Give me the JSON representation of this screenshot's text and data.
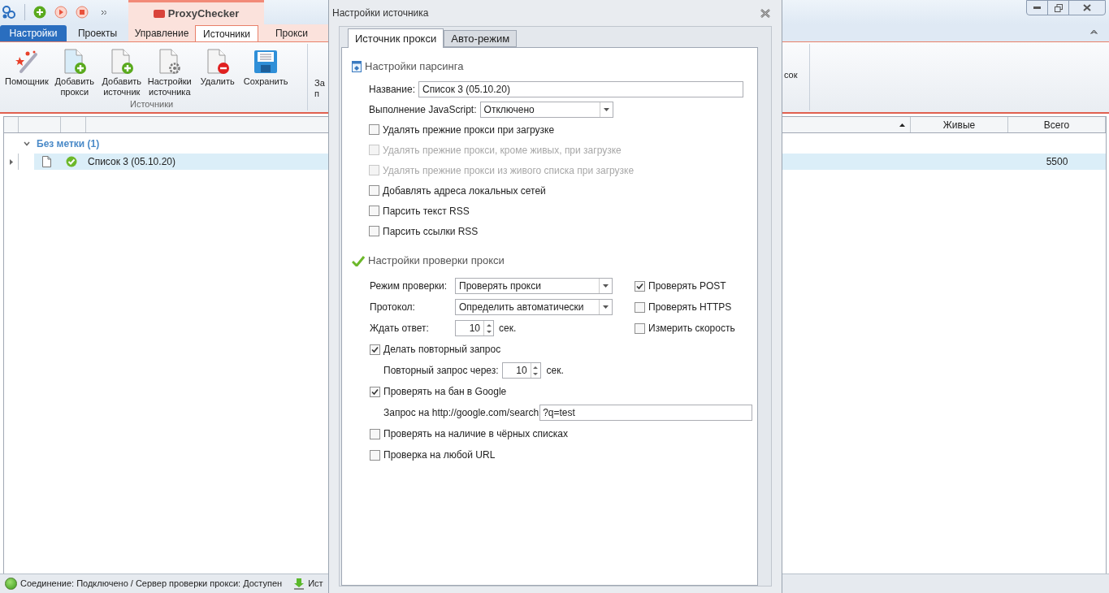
{
  "app": {
    "title": "ProxyChecker"
  },
  "ribbon": {
    "tabs": [
      {
        "label": "Настройки",
        "kind": "file",
        "selected": false
      },
      {
        "label": "Проекты",
        "kind": "plain",
        "selected": false
      },
      {
        "label": "Управление",
        "kind": "context",
        "selected": false
      },
      {
        "label": "Источники",
        "kind": "context",
        "selected": true
      },
      {
        "label": "Прокси",
        "kind": "context",
        "selected": false
      }
    ],
    "buttons": [
      {
        "kind": "wand",
        "label": "Помощник"
      },
      {
        "kind": "add-proxy",
        "label": "Добавить прокси"
      },
      {
        "kind": "add-source",
        "label": "Добавить источник"
      },
      {
        "kind": "settings",
        "label": "Настройки источника"
      },
      {
        "kind": "delete",
        "label": "Удалить"
      },
      {
        "kind": "save",
        "label": "Сохранить"
      }
    ],
    "group_label": "Источники",
    "cut_button_lines": [
      "За",
      "п"
    ],
    "cut_right_label": "сок"
  },
  "grid": {
    "columns": [
      {
        "label": "Живые"
      },
      {
        "label": "Всего"
      }
    ],
    "groups": [
      {
        "label": "Без метки (1)",
        "expanded": true,
        "rows": [
          {
            "name": "Список 3 (05.10.20)",
            "selected": true,
            "live": "",
            "total": "5500"
          }
        ]
      }
    ]
  },
  "status_bar": {
    "connection": "Соединение: Подключено / Сервер проверки прокси: Доступен",
    "next": "Ист"
  },
  "dialog": {
    "title": "Настройки источника",
    "tabs": [
      {
        "label": "Источник прокси",
        "selected": true
      },
      {
        "label": "Авто-режим",
        "selected": false
      }
    ],
    "parsing": {
      "title": "Настройки парсинга",
      "name_label": "Название:",
      "name_value": "Список 3 (05.10.20)",
      "js_label": "Выполнение JavaScript:",
      "js_value": "Отключено",
      "checkboxes": [
        {
          "label": "Удалять прежние прокси при загрузке",
          "checked": false,
          "disabled": false
        },
        {
          "label": "Удалять прежние прокси, кроме живых, при загрузке",
          "checked": false,
          "disabled": true
        },
        {
          "label": "Удалять прежние прокси из живого списка при загрузке",
          "checked": false,
          "disabled": true
        },
        {
          "label": "Добавлять адреса локальных сетей",
          "checked": false,
          "disabled": false
        },
        {
          "label": "Парсить текст RSS",
          "checked": false,
          "disabled": false
        },
        {
          "label": "Парсить ссылки RSS",
          "checked": false,
          "disabled": false
        }
      ]
    },
    "checking": {
      "title": "Настройки проверки прокси",
      "mode_label": "Режим проверки:",
      "mode_value": "Проверять прокси",
      "protocol_label": "Протокол:",
      "protocol_value": "Определить автоматически",
      "wait_label": "Ждать ответ:",
      "wait_value": "10",
      "wait_unit": "сек.",
      "side_checkboxes": [
        {
          "label": "Проверять POST",
          "checked": true
        },
        {
          "label": "Проверять HTTPS",
          "checked": false
        },
        {
          "label": "Измерить скорость",
          "checked": false
        }
      ],
      "retry": {
        "label": "Делать повторный запрос",
        "checked": true,
        "delay_label": "Повторный запрос через:",
        "delay_value": "10",
        "delay_unit": "сек."
      },
      "google": {
        "label": "Проверять на бан в Google",
        "checked": true,
        "query_label": "Запрос на http://google.com/search",
        "query_value": "?q=test"
      },
      "checkboxes": [
        {
          "label": "Проверять на наличие в чёрных списках",
          "checked": false
        },
        {
          "label": "Проверка на любой URL",
          "checked": false
        }
      ]
    }
  }
}
